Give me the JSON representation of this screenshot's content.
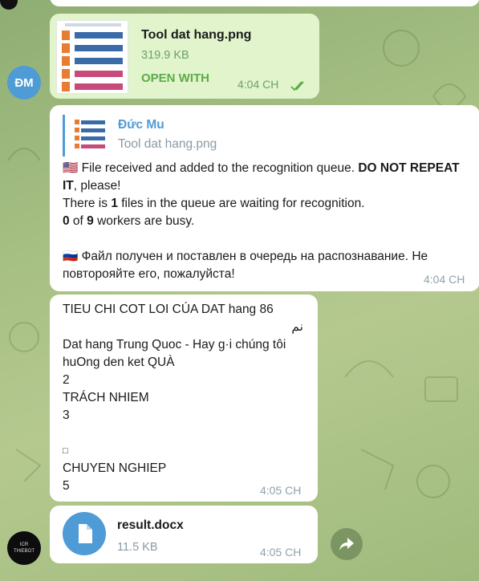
{
  "msg1": {
    "file_name": "Tool dat hang.png",
    "file_size": "319.9 KB",
    "action": "OPEN WITH",
    "time": "4:04 CH"
  },
  "avatar_user": {
    "initials": "ĐM",
    "color": "#4f9bd6"
  },
  "msg2": {
    "reply_author": "Đức Mu",
    "reply_file": "Tool dat hang.png",
    "en_flag": "🇺🇸",
    "en_p1_a": "File received and added to the recognition queue. ",
    "en_p1_bold": "DO NOT REPEAT IT",
    "en_p1_b": ", please!",
    "en_p2_a": "There is ",
    "en_p2_num": "1",
    "en_p2_b": " files in the queue are waiting for recognition.",
    "en_p3_num1": "0",
    "en_p3_a": " of ",
    "en_p3_num2": "9",
    "en_p3_b": " workers are busy.",
    "ru_flag": "🇷🇺",
    "ru_text": "Файл получен и поставлен в очередь на распознавание. Не повторояйте его, пожалуйста!",
    "time": "4:04 CH"
  },
  "msg3": {
    "lines": [
      "TIEU CHI COT LOI CÚA DAT hang 86",
      "نم",
      "Dat hang Trung Quoc - Hay g·i chúng tôi",
      "huOng den ket QUÀ",
      "2",
      "TRÁCH NHIEM",
      "3",
      "",
      "□",
      "CHUYEN NGHIEP",
      "5"
    ],
    "time": "4:05 CH"
  },
  "msg4": {
    "file_name": "result.docx",
    "file_size": "11.5 KB",
    "time": "4:05 CH"
  },
  "bot_avatar": {
    "text": "ICR THIEBOT"
  },
  "icons": [
    "double-check-icon",
    "document-icon",
    "forward-icon"
  ]
}
